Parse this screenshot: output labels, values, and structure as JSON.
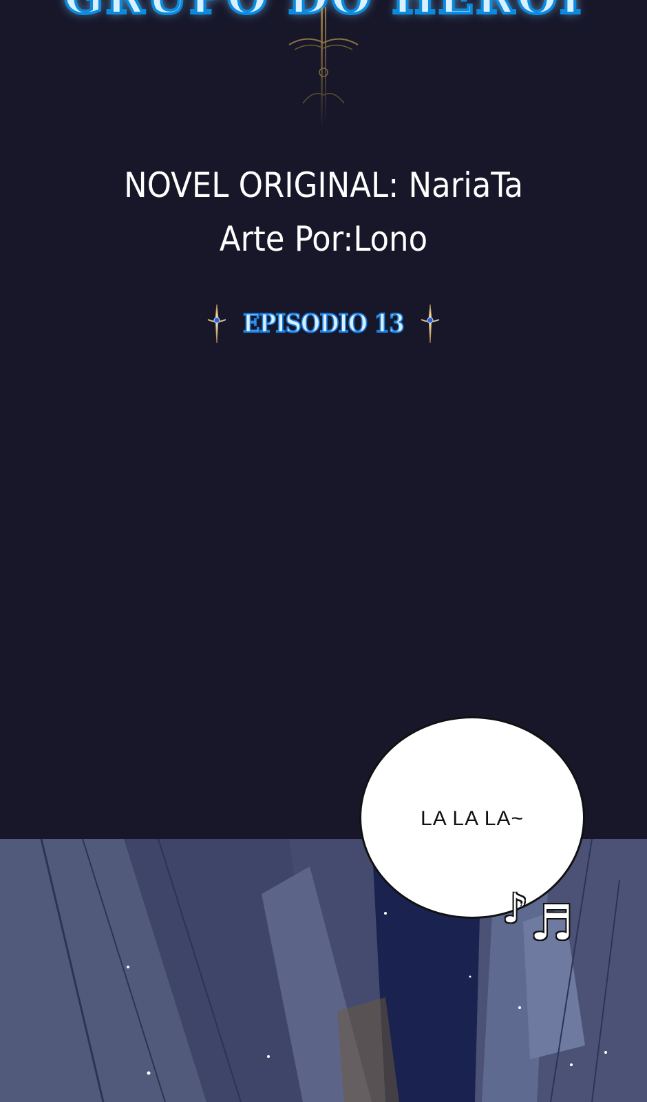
{
  "series_title": "GRUPO DO HERÓI",
  "credits": {
    "novel": "NOVEL ORIGINAL: NariaTa",
    "art": "Arte Por:Lono"
  },
  "episode": {
    "label": "EPISODIO 13",
    "left_icon": "sword-icon",
    "right_icon": "sword-icon"
  },
  "speech_bubble": {
    "text": "LA LA LA~"
  },
  "music_notes": {
    "single": "♪",
    "double": "♬"
  },
  "colors": {
    "background": "#18172a",
    "title_blue": "#0a8be0",
    "scene_blue": "#3d4466"
  }
}
